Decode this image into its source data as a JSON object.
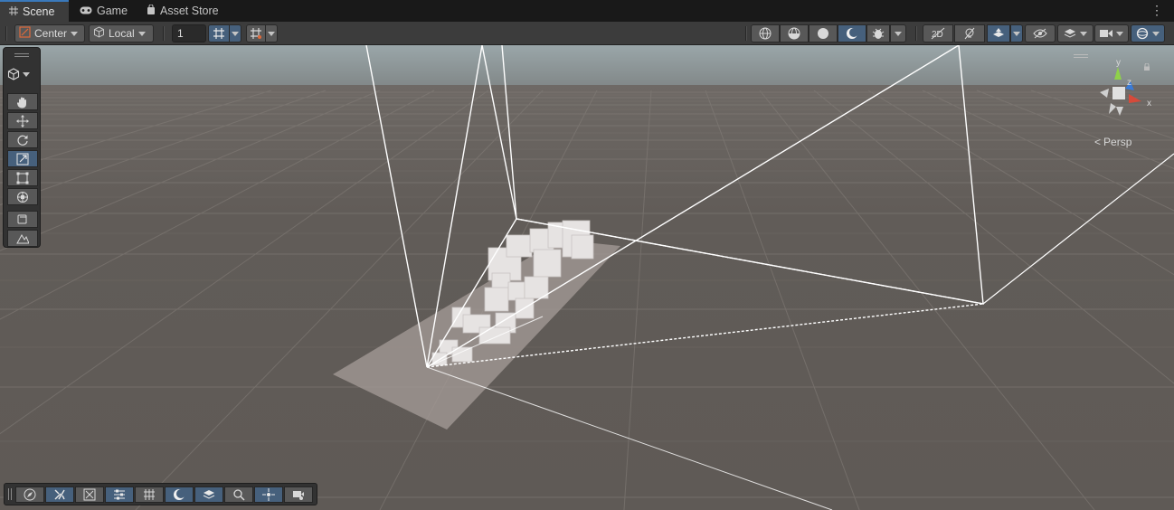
{
  "tabs": [
    {
      "label": "Scene",
      "icon": "scene-grid-icon",
      "active": true
    },
    {
      "label": "Game",
      "icon": "gamepad-icon",
      "active": false
    },
    {
      "label": "Asset Store",
      "icon": "shopping-bag-icon",
      "active": false
    }
  ],
  "toolbar": {
    "pivot_label": "Center",
    "rotation_label": "Local",
    "grid_increment": "1"
  },
  "scene": {
    "camera_mode_label": "Persp",
    "axis_labels": {
      "x": "x",
      "y": "y",
      "z": "z"
    }
  },
  "colors": {
    "accent": "#46607c",
    "background": "#191919",
    "toolbar": "#3c3c3c",
    "sky": "#8b9799",
    "ground": "#645f5a",
    "x_axis": "#d64a3a",
    "y_axis": "#8fd14a",
    "z_axis": "#3a7bd6"
  },
  "tools": [
    "view-tool",
    "move-tool",
    "rotate-tool",
    "scale-tool",
    "rect-tool",
    "transform-tool",
    "custom-tool",
    "component-tool"
  ],
  "overlays": [
    "orientation",
    "tools",
    "transform",
    "grid-snap",
    "view-options",
    "draw-mode",
    "render-layer",
    "search",
    "lighting",
    "cameras"
  ]
}
